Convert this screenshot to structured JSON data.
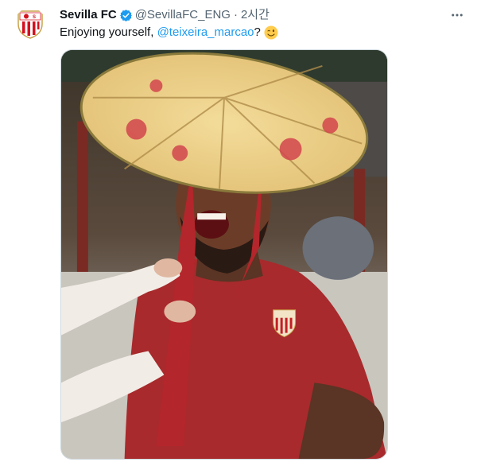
{
  "tweet": {
    "display_name": "Sevilla FC",
    "handle": "@SevillaFC_ENG",
    "separator": "·",
    "time": "2시간",
    "text_before": "Enjoying yourself, ",
    "mention": "@teixeira_marcao",
    "text_after": "?",
    "emoji": "winking-face",
    "verified": true
  },
  "avatar": {
    "icon": "sevilla-crest-icon"
  },
  "menu": {
    "icon": "more-dots-icon"
  },
  "media": {
    "kind": "photo"
  },
  "colors": {
    "link": "#1d9bf0",
    "secondary_text": "#536471",
    "verified_badge": "#1d9bf0",
    "crest_red": "#d5101e"
  }
}
